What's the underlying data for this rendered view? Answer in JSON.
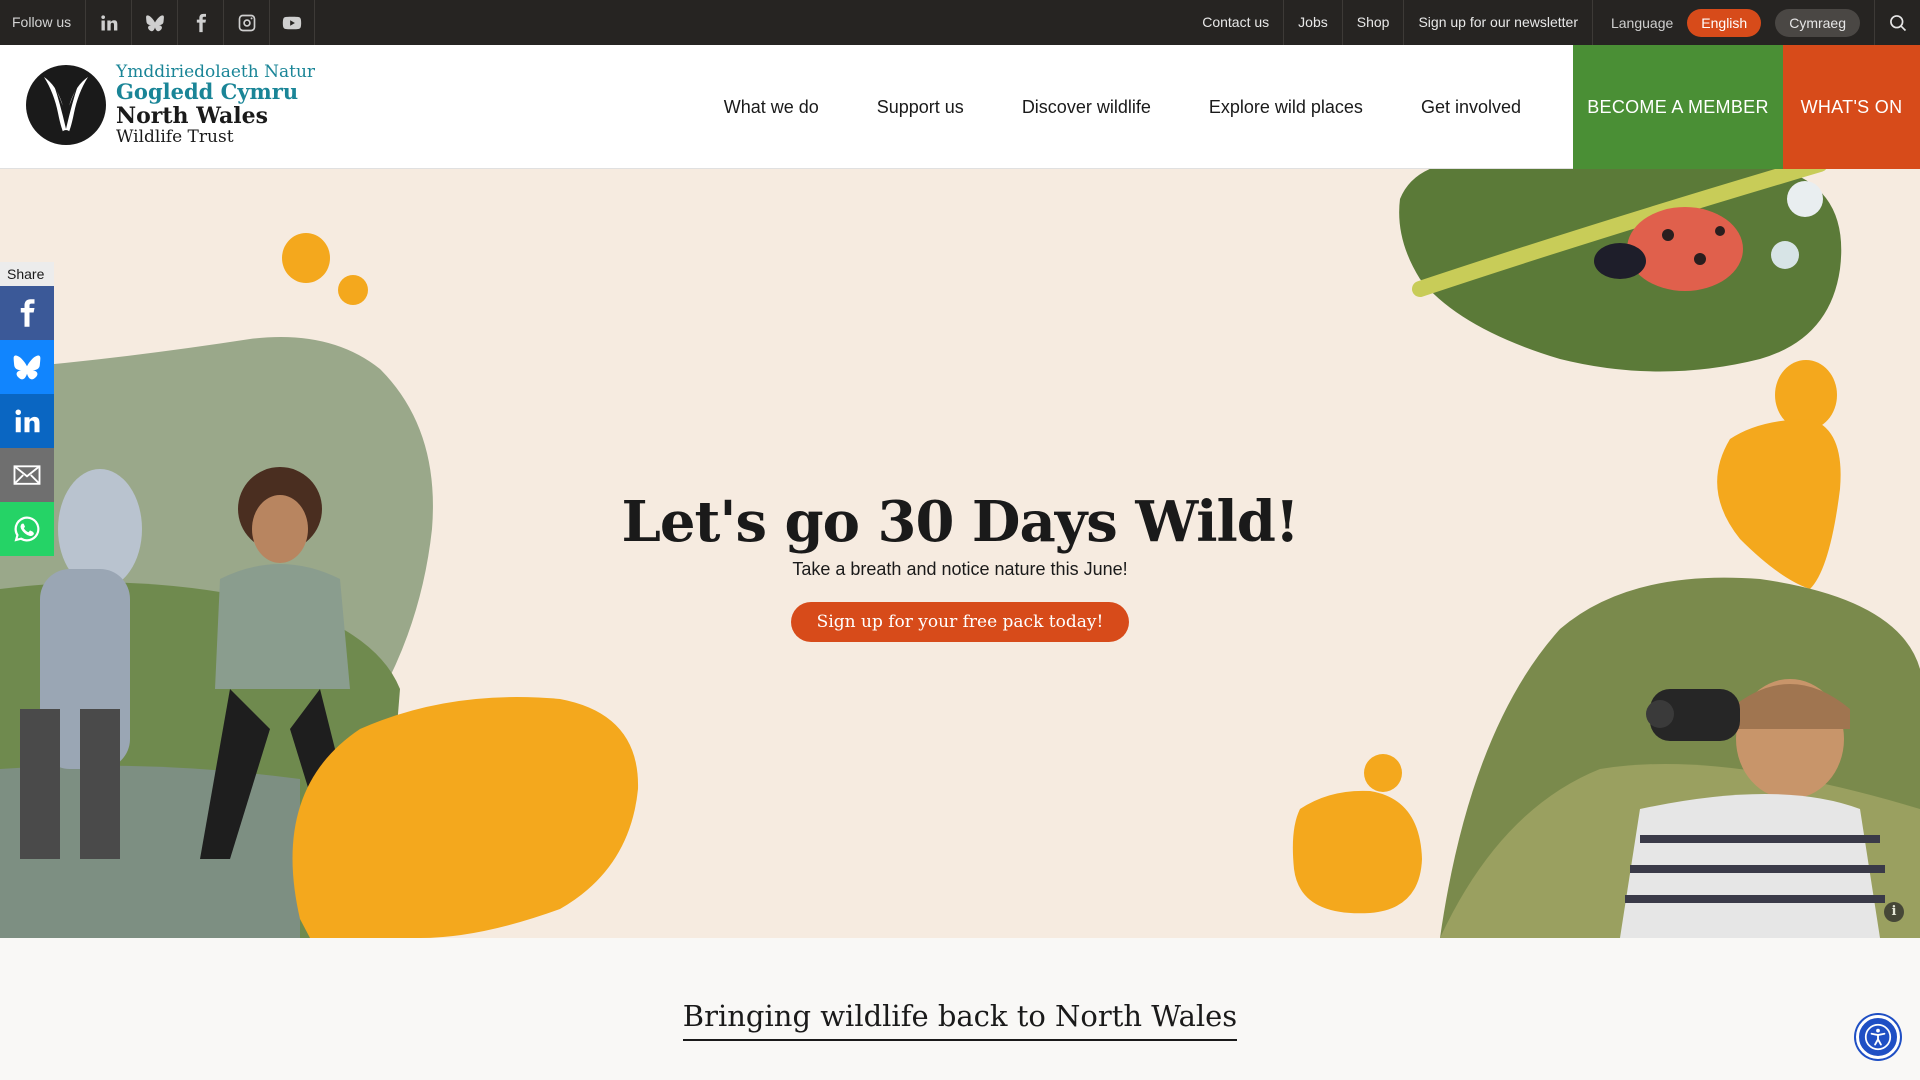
{
  "topbar": {
    "follow_label": "Follow us",
    "social": [
      {
        "name": "linkedin-icon"
      },
      {
        "name": "bluesky-icon"
      },
      {
        "name": "facebook-icon"
      },
      {
        "name": "instagram-icon"
      },
      {
        "name": "youtube-icon"
      }
    ],
    "links": [
      "Contact us",
      "Jobs",
      "Shop",
      "Sign up for our newsletter"
    ],
    "language_label": "Language",
    "languages": [
      {
        "label": "English",
        "active": true
      },
      {
        "label": "Cymraeg",
        "active": false
      }
    ],
    "search_icon": "search-icon"
  },
  "header": {
    "logo": {
      "line1": "Ymddiriedolaeth Natur",
      "line2": "Gogledd Cymru",
      "line3": "North Wales",
      "line4": "Wildlife Trust"
    },
    "nav": [
      "What we do",
      "Support us",
      "Discover wildlife",
      "Explore wild places",
      "Get involved"
    ],
    "member_cta": "BECOME A MEMBER",
    "whatson_cta": "WHAT'S ON"
  },
  "hero": {
    "title": "Let's go 30 Days Wild!",
    "subtitle": "Take a breath and notice nature this June!",
    "button": "Sign up for your free pack today!",
    "info": "i"
  },
  "share": {
    "label": "Share",
    "buttons": [
      "facebook-icon",
      "bluesky-icon",
      "linkedin-icon",
      "email-icon",
      "whatsapp-icon"
    ]
  },
  "section": {
    "title": "Bringing wildlife back to North Wales"
  },
  "colors": {
    "topbar_bg": "#262422",
    "accent_orange": "#d74b1a",
    "member_green": "#4a8f35",
    "logo_teal": "#1a8597",
    "hero_bg": "#f6ebe0",
    "blob_yellow": "#f4a81d"
  }
}
